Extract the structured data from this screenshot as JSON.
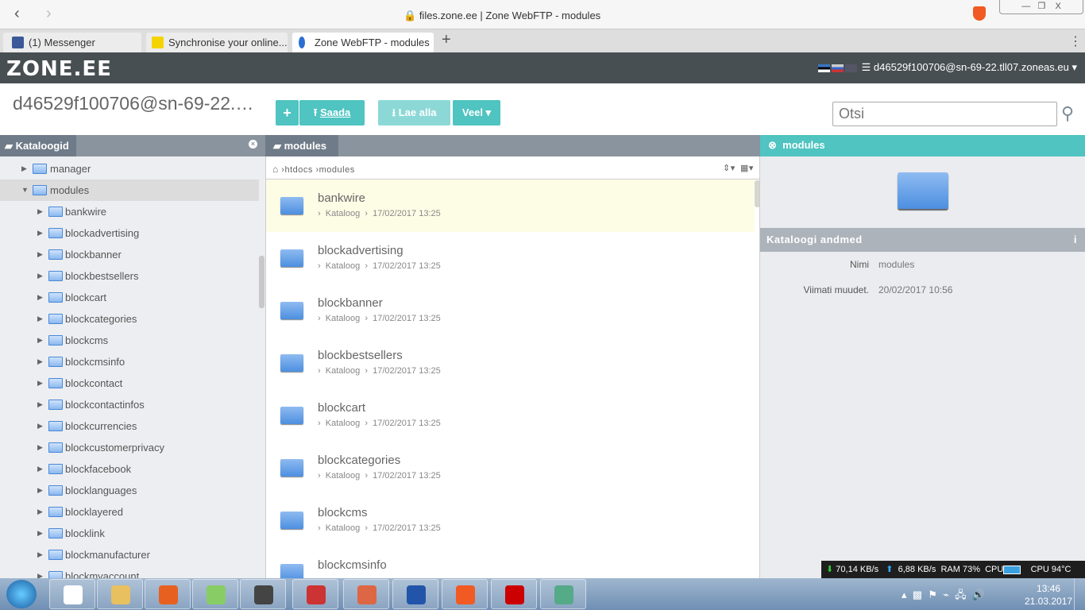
{
  "browser": {
    "address": "files.zone.ee",
    "page_title": "Zone WebFTP - modules",
    "tabs": [
      {
        "label": "(1) Messenger",
        "color": "#3b5998"
      },
      {
        "label": "Synchronise your online...",
        "color": "#f4d400"
      },
      {
        "label": "Zone WebFTP - modules",
        "color": "#2a6fd1"
      }
    ],
    "new_tab": "+",
    "menu": "⋮"
  },
  "header": {
    "logo": "ZONE.EE",
    "account": "d46529f100706@sn-69-22.tll07.zoneas.eu"
  },
  "toolbar": {
    "title": "d46529f100706@sn-69-22.…",
    "add": "+",
    "upload": "Saada",
    "download": "Lae alla",
    "more": "Veel ▾",
    "search_placeholder": "Otsi"
  },
  "tree": {
    "header": "Kataloogid",
    "parents": [
      {
        "label": "manager"
      },
      {
        "label": "modules"
      }
    ],
    "children": [
      "bankwire",
      "blockadvertising",
      "blockbanner",
      "blockbestsellers",
      "blockcart",
      "blockcategories",
      "blockcms",
      "blockcmsinfo",
      "blockcontact",
      "blockcontactinfos",
      "blockcurrencies",
      "blockcustomerprivacy",
      "blockfacebook",
      "blocklanguages",
      "blocklayered",
      "blocklink",
      "blockmanufacturer",
      "blockmyaccount"
    ]
  },
  "list": {
    "header": "modules",
    "crumbs": [
      "htdocs",
      "modules"
    ],
    "items": [
      {
        "name": "bankwire",
        "type": "Kataloog",
        "date": "17/02/2017 13:25"
      },
      {
        "name": "blockadvertising",
        "type": "Kataloog",
        "date": "17/02/2017 13:25"
      },
      {
        "name": "blockbanner",
        "type": "Kataloog",
        "date": "17/02/2017 13:25"
      },
      {
        "name": "blockbestsellers",
        "type": "Kataloog",
        "date": "17/02/2017 13:25"
      },
      {
        "name": "blockcart",
        "type": "Kataloog",
        "date": "17/02/2017 13:25"
      },
      {
        "name": "blockcategories",
        "type": "Kataloog",
        "date": "17/02/2017 13:25"
      },
      {
        "name": "blockcms",
        "type": "Kataloog",
        "date": "17/02/2017 13:25"
      },
      {
        "name": "blockcmsinfo",
        "type": "",
        "date": ""
      }
    ]
  },
  "details": {
    "header": "modules",
    "section": "Kataloogi andmed",
    "name_label": "Nimi",
    "name_value": "modules",
    "modified_label": "Viimati muudet.",
    "modified_value": "20/02/2017 10:56"
  },
  "status": {
    "down": "70,14 KB/s",
    "up": "6,88 KB/s",
    "ram": "RAM 73%",
    "cpu": "CPU",
    "cpu_temp": "CPU 94°C"
  },
  "clock": {
    "time": "13:46",
    "date": "21.03.2017"
  }
}
